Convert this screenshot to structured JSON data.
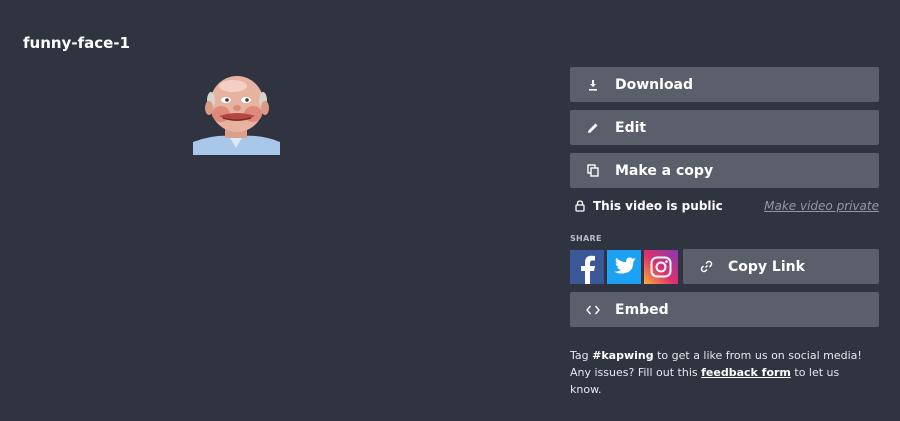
{
  "page": {
    "title": "funny-face-1"
  },
  "thumbnail": {
    "alt": "funny-face-1"
  },
  "actions": {
    "download": {
      "label": "Download",
      "icon": "download-icon"
    },
    "edit": {
      "label": "Edit",
      "icon": "pencil-icon"
    },
    "copy": {
      "label": "Make a copy",
      "icon": "copy-icon"
    }
  },
  "privacy": {
    "status": "This video is public",
    "toggle_link": "Make video private",
    "icon": "lock-icon"
  },
  "share": {
    "label": "SHARE",
    "facebook_icon": "facebook-icon",
    "twitter_icon": "twitter-icon",
    "instagram_icon": "instagram-icon",
    "copy_link_label": "Copy Link",
    "embed_label": "Embed"
  },
  "footer": {
    "prefix": "Tag ",
    "hashtag": "#kapwing",
    "middle": " to get a like from us on social media! Any issues? Fill out this ",
    "link": "feedback form",
    "suffix": " to let us know."
  },
  "colors": {
    "background": "#2f3440",
    "button": "#5b5e6b",
    "facebook": "#3b5998",
    "twitter": "#1da1f2"
  }
}
